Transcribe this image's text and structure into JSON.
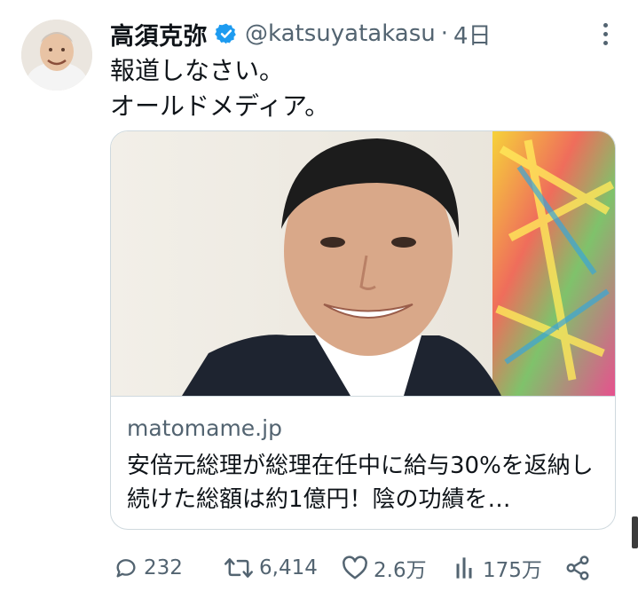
{
  "tweet": {
    "display_name": "高須克弥",
    "handle": "@katsuyatakasu",
    "separator": "·",
    "timestamp": "4日",
    "text_lines": [
      "報道しなさい。",
      "オールドメディア。"
    ],
    "verified": true
  },
  "card": {
    "domain": "matomame.jp",
    "title": "安倍元総理が総理在任中に給与30%を返納し続けた総額は約1億円！陰の功績を…"
  },
  "actions": {
    "replies": "232",
    "retweets": "6,414",
    "likes": "2.6万",
    "views": "175万"
  },
  "icons": {
    "verified": "verified-badge-icon",
    "more": "more-dots-icon",
    "reply": "reply-bubble-icon",
    "retweet": "retweet-icon",
    "like": "heart-icon",
    "views": "bar-chart-icon",
    "share": "share-icon"
  },
  "colors": {
    "accent_blue": "#1d9bf0",
    "secondary_text": "#536471",
    "primary_text": "#0f1419",
    "border": "#cfd9de"
  }
}
